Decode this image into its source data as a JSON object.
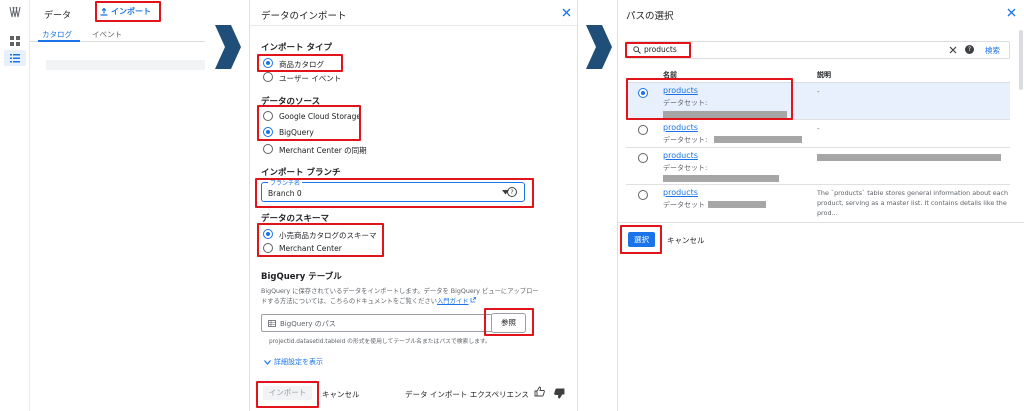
{
  "panel1": {
    "nav_title": "データ",
    "import_button": "インポート",
    "tabs": [
      "カタログ",
      "イベント"
    ]
  },
  "panel2": {
    "title": "データのインポート",
    "import_type": {
      "heading": "インポート タイプ",
      "options": [
        "商品カタログ",
        "ユーザー イベント"
      ],
      "selected": 0
    },
    "source": {
      "heading": "データのソース",
      "options": [
        "Google Cloud Storage",
        "BigQuery",
        "Merchant Center の同期"
      ],
      "selected": 1
    },
    "branch": {
      "heading": "インポート ブランチ",
      "field_label": "ブランチ名",
      "value": "Branch 0"
    },
    "schema": {
      "heading": "データのスキーマ",
      "options": [
        "小売商品カタログのスキーマ",
        "Merchant Center"
      ],
      "selected": 0
    },
    "bq_table": {
      "heading": "BigQuery テーブル",
      "desc_line1": "BigQuery に保存されているデータをインポートします。データを BigQuery ビューにアップロー",
      "desc_line2": "ドする方法については、こちらのドキュメントをご覧ください",
      "guide_link": "入門ガイド",
      "placeholder": "BigQuery のパス",
      "browse_button": "参照",
      "hint": "projectid.datasetid.tableid の形式を使用してテーブル名またはパスで検索します。"
    },
    "advanced_link": "詳細設定を表示",
    "import_button": "インポート",
    "cancel_button": "キャンセル",
    "experience_label": "データ インポート エクスペリエンス"
  },
  "panel3": {
    "title": "パスの選択",
    "search_value": "products",
    "search_button": "検索",
    "columns": {
      "name": "名前",
      "desc": "説明"
    },
    "rows": [
      {
        "name": "products",
        "dataset_label": "データセット:",
        "desc": "-"
      },
      {
        "name": "products",
        "dataset_label": "データセット:",
        "desc": "-"
      },
      {
        "name": "products",
        "dataset_label": "データセット:",
        "desc": ""
      },
      {
        "name": "products",
        "dataset_label": "データセット",
        "desc_line1": "The `products` table stores general information about each",
        "desc_line2": "product, serving as a master list. It contains details like the",
        "desc_line3": "prod..."
      }
    ],
    "select_button": "選択",
    "cancel_button": "キャンセル"
  },
  "colors": {
    "accent": "#1a73e8",
    "highlight": "#e2141b",
    "arrow": "#1f4e79"
  }
}
